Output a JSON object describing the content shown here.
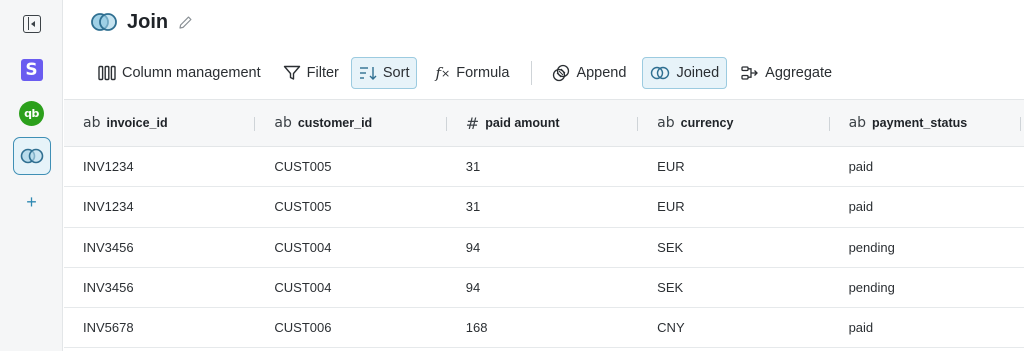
{
  "rail": {
    "stripe_letter": "S",
    "qb_letters": "qb",
    "add_symbol": "+"
  },
  "header": {
    "title": "Join"
  },
  "toolbar": {
    "column_management": "Column management",
    "filter": "Filter",
    "sort": "Sort",
    "formula": "Formula",
    "append": "Append",
    "joined": "Joined",
    "aggregate": "Aggregate"
  },
  "table": {
    "columns": [
      {
        "type": "ab",
        "name": "invoice_id"
      },
      {
        "type": "ab",
        "name": "customer_id"
      },
      {
        "type": "#",
        "name": "paid amount"
      },
      {
        "type": "ab",
        "name": "currency"
      },
      {
        "type": "ab",
        "name": "payment_status"
      }
    ],
    "rows": [
      [
        "INV1234",
        "CUST005",
        "31",
        "EUR",
        "paid"
      ],
      [
        "INV1234",
        "CUST005",
        "31",
        "EUR",
        "paid"
      ],
      [
        "INV3456",
        "CUST004",
        "94",
        "SEK",
        "pending"
      ],
      [
        "INV3456",
        "CUST004",
        "94",
        "SEK",
        "pending"
      ],
      [
        "INV5678",
        "CUST006",
        "168",
        "CNY",
        "paid"
      ]
    ]
  },
  "colors": {
    "accent": "#3f8fb5",
    "active_bg": "#e7f3f9",
    "stripe": "#6a5cf0",
    "quickbooks": "#2ca01c"
  },
  "icons": [
    "sidebar-collapse-icon",
    "stripe-icon",
    "quickbooks-icon",
    "join-icon",
    "plus-icon",
    "pencil-icon",
    "columns-icon",
    "filter-icon",
    "sort-icon",
    "formula-icon",
    "append-icon",
    "joined-icon",
    "aggregate-icon"
  ]
}
